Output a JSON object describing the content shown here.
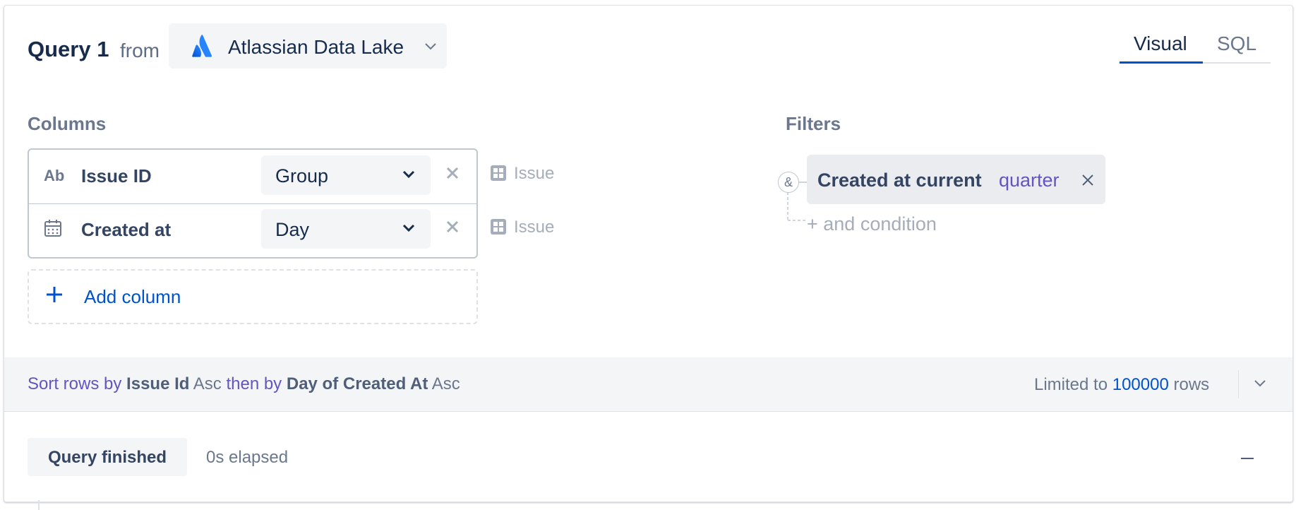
{
  "query": {
    "title": "Query 1",
    "from_label": "from",
    "source": {
      "name": "Atlassian Data Lake",
      "logo_icon": "atlassian-logo-icon"
    }
  },
  "mode_tabs": [
    {
      "label": "Visual",
      "selected": true
    },
    {
      "label": "SQL",
      "selected": false
    }
  ],
  "columns": {
    "label": "Columns",
    "items": [
      {
        "type_label": "Ab",
        "type_icon": "text-type-icon",
        "name": "Issue ID",
        "aggregation": "Group",
        "entity": "Issue",
        "entity_icon": "table-icon"
      },
      {
        "type_label": "",
        "type_icon": "calendar-icon",
        "name": "Created at",
        "aggregation": "Day",
        "entity": "Issue",
        "entity_icon": "table-icon"
      }
    ],
    "add_label": "Add column"
  },
  "filters": {
    "label": "Filters",
    "conjunction": "&",
    "items": [
      {
        "text": "Created at current",
        "value": "quarter"
      }
    ],
    "add_label": "+ and condition"
  },
  "sort": {
    "prefix": "Sort rows by",
    "field1": "Issue Id",
    "dir1": "Asc",
    "then": "then by",
    "field2": "Day of Created At",
    "dir2": "Asc"
  },
  "limit": {
    "prefix": "Limited to",
    "value": "100000",
    "suffix": "rows"
  },
  "status": {
    "label": "Query finished",
    "elapsed": "0s elapsed"
  },
  "colors": {
    "accent": "#0052cc",
    "purple": "#6554c0",
    "muted": "#6b778c",
    "surface": "#f4f5f7"
  }
}
